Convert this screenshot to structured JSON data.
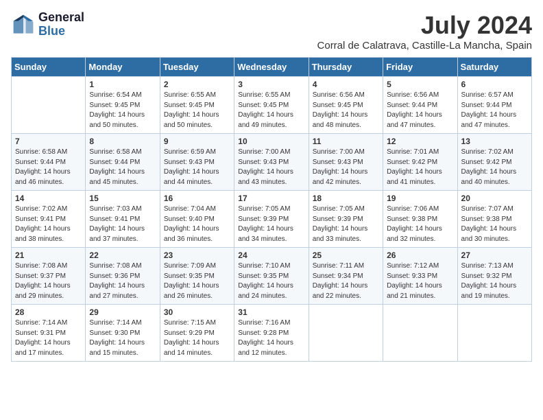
{
  "logo": {
    "line1": "General",
    "line2": "Blue"
  },
  "title": {
    "month_year": "July 2024",
    "location": "Corral de Calatrava, Castille-La Mancha, Spain"
  },
  "headers": [
    "Sunday",
    "Monday",
    "Tuesday",
    "Wednesday",
    "Thursday",
    "Friday",
    "Saturday"
  ],
  "weeks": [
    [
      {
        "day": "",
        "content": ""
      },
      {
        "day": "1",
        "content": "Sunrise: 6:54 AM\nSunset: 9:45 PM\nDaylight: 14 hours\nand 50 minutes."
      },
      {
        "day": "2",
        "content": "Sunrise: 6:55 AM\nSunset: 9:45 PM\nDaylight: 14 hours\nand 50 minutes."
      },
      {
        "day": "3",
        "content": "Sunrise: 6:55 AM\nSunset: 9:45 PM\nDaylight: 14 hours\nand 49 minutes."
      },
      {
        "day": "4",
        "content": "Sunrise: 6:56 AM\nSunset: 9:45 PM\nDaylight: 14 hours\nand 48 minutes."
      },
      {
        "day": "5",
        "content": "Sunrise: 6:56 AM\nSunset: 9:44 PM\nDaylight: 14 hours\nand 47 minutes."
      },
      {
        "day": "6",
        "content": "Sunrise: 6:57 AM\nSunset: 9:44 PM\nDaylight: 14 hours\nand 47 minutes."
      }
    ],
    [
      {
        "day": "7",
        "content": "Sunrise: 6:58 AM\nSunset: 9:44 PM\nDaylight: 14 hours\nand 46 minutes."
      },
      {
        "day": "8",
        "content": "Sunrise: 6:58 AM\nSunset: 9:44 PM\nDaylight: 14 hours\nand 45 minutes."
      },
      {
        "day": "9",
        "content": "Sunrise: 6:59 AM\nSunset: 9:43 PM\nDaylight: 14 hours\nand 44 minutes."
      },
      {
        "day": "10",
        "content": "Sunrise: 7:00 AM\nSunset: 9:43 PM\nDaylight: 14 hours\nand 43 minutes."
      },
      {
        "day": "11",
        "content": "Sunrise: 7:00 AM\nSunset: 9:43 PM\nDaylight: 14 hours\nand 42 minutes."
      },
      {
        "day": "12",
        "content": "Sunrise: 7:01 AM\nSunset: 9:42 PM\nDaylight: 14 hours\nand 41 minutes."
      },
      {
        "day": "13",
        "content": "Sunrise: 7:02 AM\nSunset: 9:42 PM\nDaylight: 14 hours\nand 40 minutes."
      }
    ],
    [
      {
        "day": "14",
        "content": "Sunrise: 7:02 AM\nSunset: 9:41 PM\nDaylight: 14 hours\nand 38 minutes."
      },
      {
        "day": "15",
        "content": "Sunrise: 7:03 AM\nSunset: 9:41 PM\nDaylight: 14 hours\nand 37 minutes."
      },
      {
        "day": "16",
        "content": "Sunrise: 7:04 AM\nSunset: 9:40 PM\nDaylight: 14 hours\nand 36 minutes."
      },
      {
        "day": "17",
        "content": "Sunrise: 7:05 AM\nSunset: 9:39 PM\nDaylight: 14 hours\nand 34 minutes."
      },
      {
        "day": "18",
        "content": "Sunrise: 7:05 AM\nSunset: 9:39 PM\nDaylight: 14 hours\nand 33 minutes."
      },
      {
        "day": "19",
        "content": "Sunrise: 7:06 AM\nSunset: 9:38 PM\nDaylight: 14 hours\nand 32 minutes."
      },
      {
        "day": "20",
        "content": "Sunrise: 7:07 AM\nSunset: 9:38 PM\nDaylight: 14 hours\nand 30 minutes."
      }
    ],
    [
      {
        "day": "21",
        "content": "Sunrise: 7:08 AM\nSunset: 9:37 PM\nDaylight: 14 hours\nand 29 minutes."
      },
      {
        "day": "22",
        "content": "Sunrise: 7:08 AM\nSunset: 9:36 PM\nDaylight: 14 hours\nand 27 minutes."
      },
      {
        "day": "23",
        "content": "Sunrise: 7:09 AM\nSunset: 9:35 PM\nDaylight: 14 hours\nand 26 minutes."
      },
      {
        "day": "24",
        "content": "Sunrise: 7:10 AM\nSunset: 9:35 PM\nDaylight: 14 hours\nand 24 minutes."
      },
      {
        "day": "25",
        "content": "Sunrise: 7:11 AM\nSunset: 9:34 PM\nDaylight: 14 hours\nand 22 minutes."
      },
      {
        "day": "26",
        "content": "Sunrise: 7:12 AM\nSunset: 9:33 PM\nDaylight: 14 hours\nand 21 minutes."
      },
      {
        "day": "27",
        "content": "Sunrise: 7:13 AM\nSunset: 9:32 PM\nDaylight: 14 hours\nand 19 minutes."
      }
    ],
    [
      {
        "day": "28",
        "content": "Sunrise: 7:14 AM\nSunset: 9:31 PM\nDaylight: 14 hours\nand 17 minutes."
      },
      {
        "day": "29",
        "content": "Sunrise: 7:14 AM\nSunset: 9:30 PM\nDaylight: 14 hours\nand 15 minutes."
      },
      {
        "day": "30",
        "content": "Sunrise: 7:15 AM\nSunset: 9:29 PM\nDaylight: 14 hours\nand 14 minutes."
      },
      {
        "day": "31",
        "content": "Sunrise: 7:16 AM\nSunset: 9:28 PM\nDaylight: 14 hours\nand 12 minutes."
      },
      {
        "day": "",
        "content": ""
      },
      {
        "day": "",
        "content": ""
      },
      {
        "day": "",
        "content": ""
      }
    ]
  ]
}
